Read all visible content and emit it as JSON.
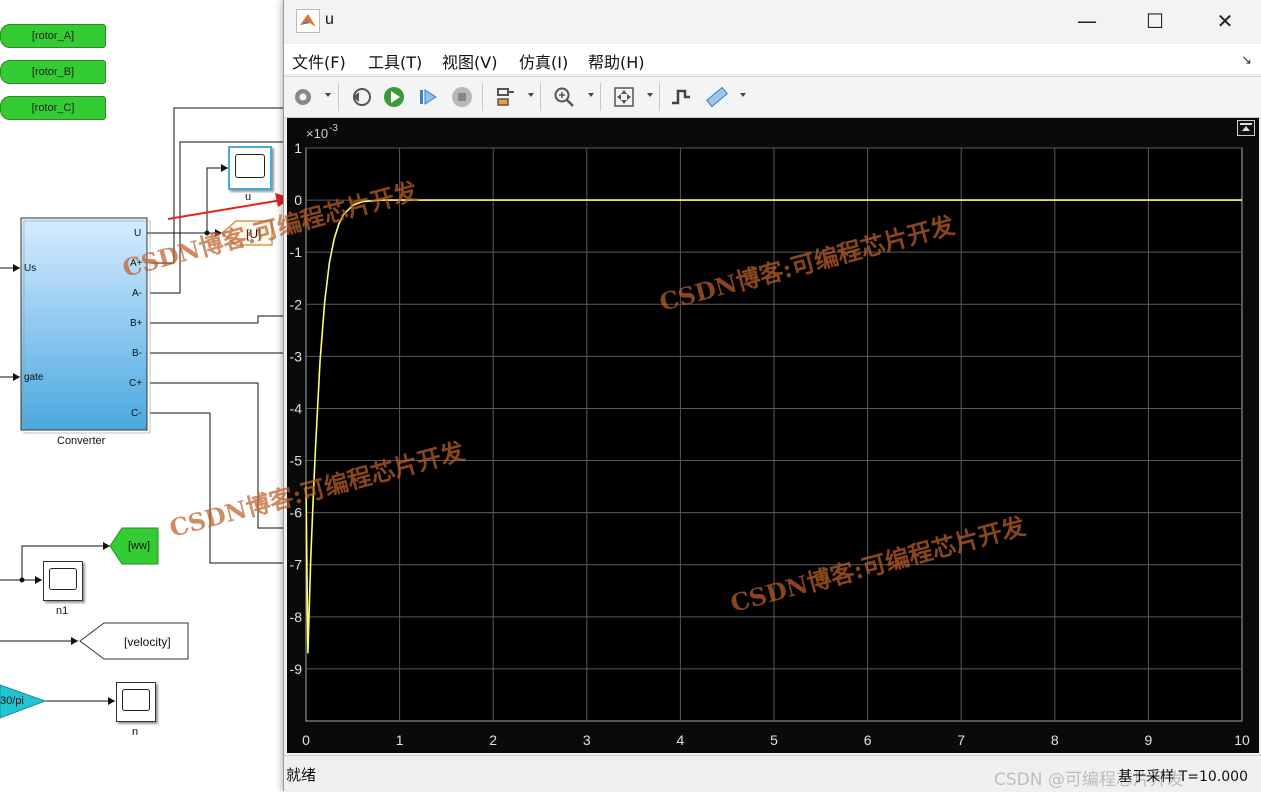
{
  "diagram": {
    "goto_tags": [
      "[rotor_A]",
      "[rotor_B]",
      "[rotor_C]"
    ],
    "converter": {
      "name": "Converter",
      "inputs": [
        "Us",
        "gate"
      ],
      "outputs": [
        "U",
        "A+",
        "A-",
        "B+",
        "B-",
        "C+",
        "C-"
      ]
    },
    "scope_u_label": "u",
    "goto_U": "[U]",
    "goto_ww": "[ww]",
    "scope_n1_label": "n1",
    "goto_velocity": "[velocity]",
    "gain_label": "30/pi",
    "scope_n_label": "n"
  },
  "window": {
    "title": "u",
    "controls": {
      "minimize": "—",
      "maximize": "☐",
      "close": "✕"
    },
    "menu": [
      "文件(F)",
      "工具(T)",
      "视图(V)",
      "仿真(I)",
      "帮助(H)"
    ],
    "toolbar_icons": [
      "settings-gear-icon",
      "step-back-icon",
      "run-icon",
      "step-forward-icon",
      "stop-icon",
      "highlight-icon",
      "zoom-icon",
      "fit-to-view-icon",
      "trigger-icon",
      "measure-icon"
    ],
    "status_left": "就绪",
    "status_right": "基于采样  T=10.000",
    "credit": "CSDN @可编程芯片开发"
  },
  "watermarks": [
    "CSDN博客:可编程芯片开发",
    "CSDN博客:可编程芯片开发",
    "CSDN博客:可编程芯片开发",
    "CSDN博客:可编程芯片开发"
  ],
  "colors": {
    "trace": "#ffff66",
    "plot_bg": "#000000",
    "grid": "#5a5a5a",
    "goto_green": "#33cc33",
    "gain_cyan": "#22c4d4",
    "converter_top": "#d7ecff",
    "converter_bottom": "#4aa8e0"
  },
  "chart_data": {
    "type": "line",
    "exponent_label": "×10^{-3}",
    "exponent_text": "×10",
    "exponent_power": "-3",
    "xlim": [
      0,
      10
    ],
    "ylim": [
      -10,
      1
    ],
    "x_ticks": [
      "0",
      "1",
      "2",
      "3",
      "4",
      "5",
      "6",
      "7",
      "8",
      "9",
      "10"
    ],
    "y_ticks": [
      "1",
      "0",
      "-1",
      "-2",
      "-3",
      "-4",
      "-5",
      "-6",
      "-7",
      "-8",
      "-9"
    ],
    "y_tick_values": [
      1,
      0,
      -1,
      -2,
      -3,
      -4,
      -5,
      -6,
      -7,
      -8,
      -9
    ],
    "grid": true,
    "series": [
      {
        "color": "#ffff66",
        "x": [
          0,
          0.02,
          0.05,
          0.08,
          0.1,
          0.15,
          0.2,
          0.25,
          0.3,
          0.35,
          0.4,
          0.5,
          0.6,
          0.8,
          1,
          2,
          4,
          6,
          8,
          10
        ],
        "y": [
          -5.5,
          -8.7,
          -6.9,
          -5.6,
          -4.8,
          -3.1,
          -1.95,
          -1.2,
          -0.75,
          -0.46,
          -0.28,
          -0.1,
          -0.03,
          0,
          0,
          0,
          0,
          0,
          0,
          0
        ]
      }
    ]
  }
}
